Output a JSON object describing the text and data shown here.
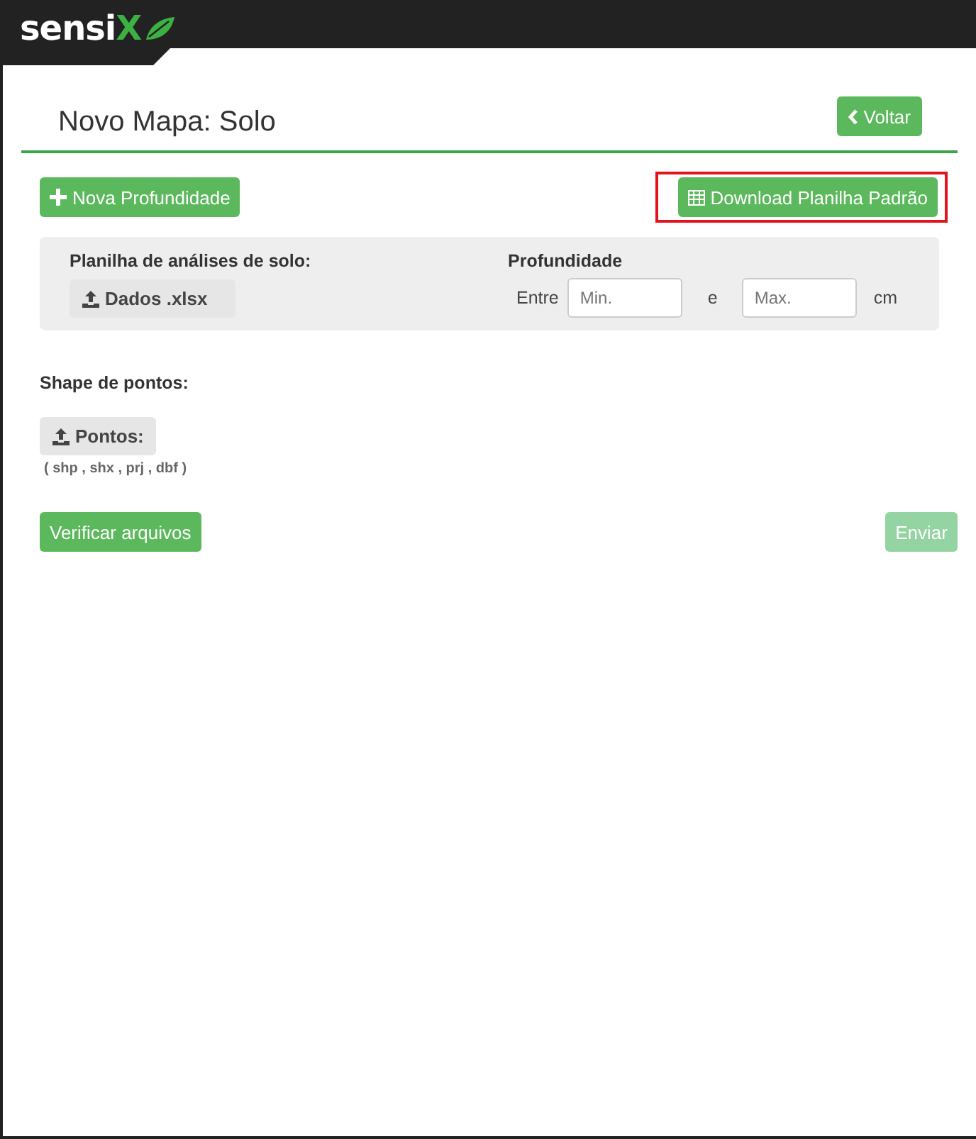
{
  "logo": {
    "text": "sensi",
    "accent": "X"
  },
  "page": {
    "title": "Novo Mapa: Solo",
    "back_button": "Voltar"
  },
  "actions": [
    {
      "label": "Nova Profundidade",
      "kind": "add",
      "highlighted": false
    },
    {
      "label": "Download Planilha Padrão",
      "kind": "download",
      "highlighted": true
    }
  ],
  "soil_panel": {
    "sheet_label": "Planilha de análises de solo:",
    "upload_button": "Dados .xlsx",
    "depth_label": "Profundidade",
    "between": "Entre",
    "min": {
      "placeholder": "Min."
    },
    "and": "e",
    "max": {
      "placeholder": "Max."
    },
    "unit": "cm"
  },
  "shape": {
    "label": "Shape de pontos:",
    "upload_button": "Pontos:",
    "hint": "( shp , shx , prj , dbf )"
  },
  "footer_buttons": [
    {
      "label": "Verificar arquivos",
      "disabled": false
    },
    {
      "label": "Enviar",
      "disabled": true
    }
  ]
}
